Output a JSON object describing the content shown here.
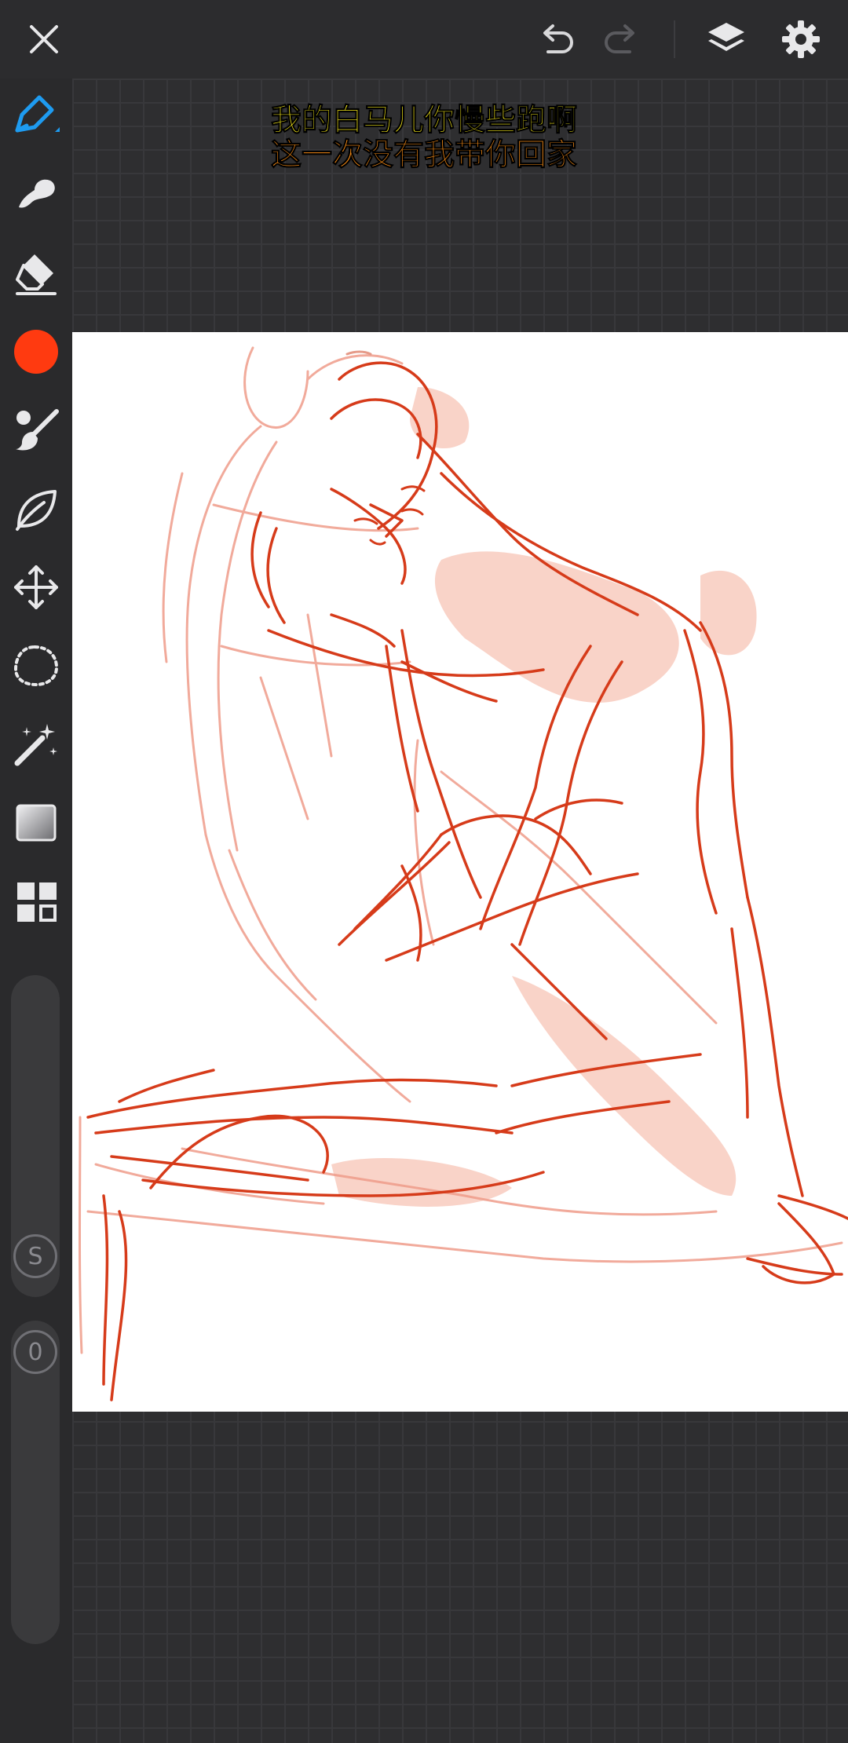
{
  "app": {
    "accent_color": "#1e9bf0",
    "brush_color": "#ff3a10"
  },
  "topbar": {
    "icons": [
      "close-icon",
      "undo-icon",
      "redo-icon",
      "layers-icon",
      "settings-icon"
    ]
  },
  "toolbar": {
    "tools": [
      "pen-icon",
      "smudge-icon",
      "eraser-icon",
      "color-swatch",
      "brush-settings-icon",
      "stabilizer-leaf-icon",
      "transform-icon",
      "lasso-select-icon",
      "magic-wand-icon",
      "gradient-icon",
      "grid-apps-icon"
    ],
    "size_slider_label": "S",
    "opacity_slider_label": "0"
  },
  "overlay": {
    "lyric_line_1": "我的白马儿你慢些跑啊",
    "lyric_line_2": "这一次没有我带你回家"
  }
}
